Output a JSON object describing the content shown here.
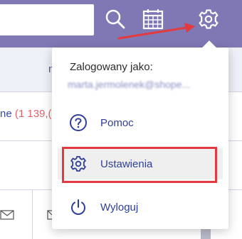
{
  "colors": {
    "header_bg": "#7f78b4",
    "menu_text": "#2e3f9a",
    "highlight_red": "#e23a3f",
    "count_red": "#e2626a"
  },
  "header": {
    "search": {
      "value": "",
      "placeholder": ""
    },
    "icons": [
      "search-icon",
      "calendar-icon",
      "gear-icon"
    ]
  },
  "background": {
    "row1_fragment": "n",
    "row2_fragment": "ne",
    "row2_count": "(1 139,("
  },
  "user_menu": {
    "logged_in_label": "Zalogowany jako:",
    "email": "marta.jermolenek@shope...",
    "items": [
      {
        "label": "Pomoc",
        "icon": "help-icon"
      },
      {
        "label": "Ustawienia",
        "icon": "gear-icon"
      },
      {
        "label": "Wyloguj",
        "icon": "power-icon"
      }
    ]
  }
}
